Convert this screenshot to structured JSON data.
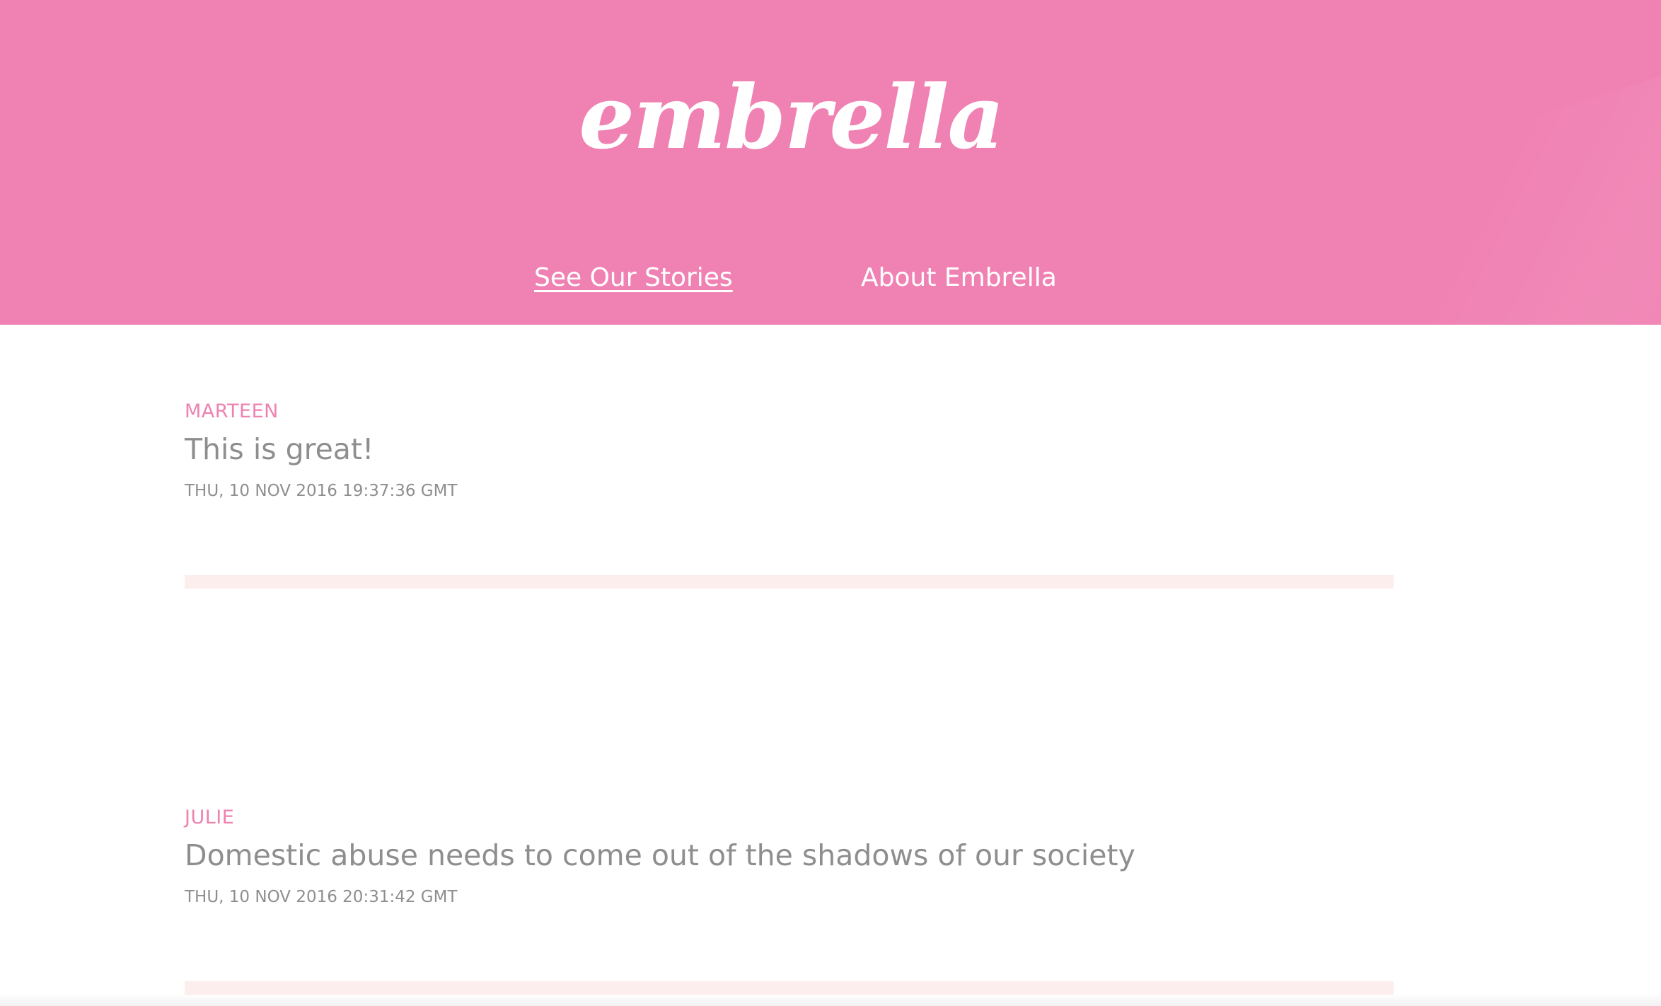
{
  "brand": {
    "logo_text": "embrella"
  },
  "nav": {
    "items": [
      {
        "label": "See Our Stories",
        "active": true
      },
      {
        "label": "About Embrella",
        "active": false
      }
    ]
  },
  "stories": [
    {
      "author": "MARTEEN",
      "message": "This is great!",
      "timestamp": "THU, 10 NOV 2016 19:37:36 GMT"
    },
    {
      "author": "JULIE",
      "message": "Domestic abuse needs to come out of the shadows of our society",
      "timestamp": "THU, 10 NOV 2016 20:31:42 GMT"
    }
  ],
  "colors": {
    "header_background": "#f082b3",
    "author_pink": "#ee82b0",
    "body_text_gray": "#8e8e8e",
    "divider_pink": "#fdeeee"
  }
}
